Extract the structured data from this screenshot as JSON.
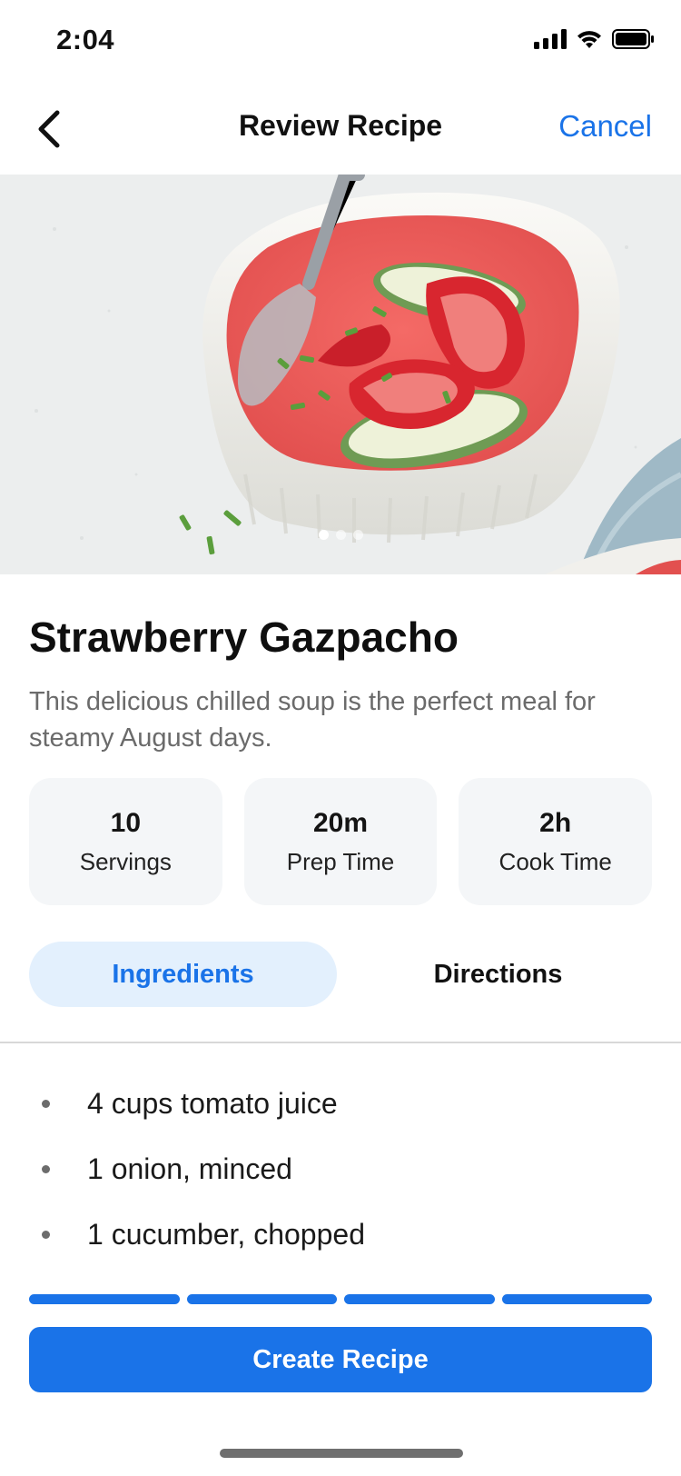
{
  "status_bar": {
    "time": "2:04"
  },
  "nav": {
    "title": "Review Recipe",
    "cancel_label": "Cancel"
  },
  "hero": {
    "image": "strawberry-gazpacho-photo",
    "page_count": 3,
    "active_page": 1
  },
  "recipe": {
    "title": "Strawberry Gazpacho",
    "description": "This delicious chilled soup is the perfect meal for steamy August days."
  },
  "stats": [
    {
      "value": "10",
      "label": "Servings"
    },
    {
      "value": "20m",
      "label": "Prep Time"
    },
    {
      "value": "2h",
      "label": "Cook Time"
    }
  ],
  "tabs": [
    {
      "label": "Ingredients",
      "active": true
    },
    {
      "label": "Directions",
      "active": false
    }
  ],
  "ingredients": [
    "4 cups tomato juice",
    "1 onion, minced",
    "1 cucumber, chopped"
  ],
  "progress": {
    "steps_total": 4,
    "steps_complete": 4
  },
  "actions": {
    "create_label": "Create Recipe"
  },
  "colors": {
    "accent": "#1a73e8",
    "tab_active_bg": "#e3f0fd",
    "stat_card_bg": "#f4f6f8"
  }
}
